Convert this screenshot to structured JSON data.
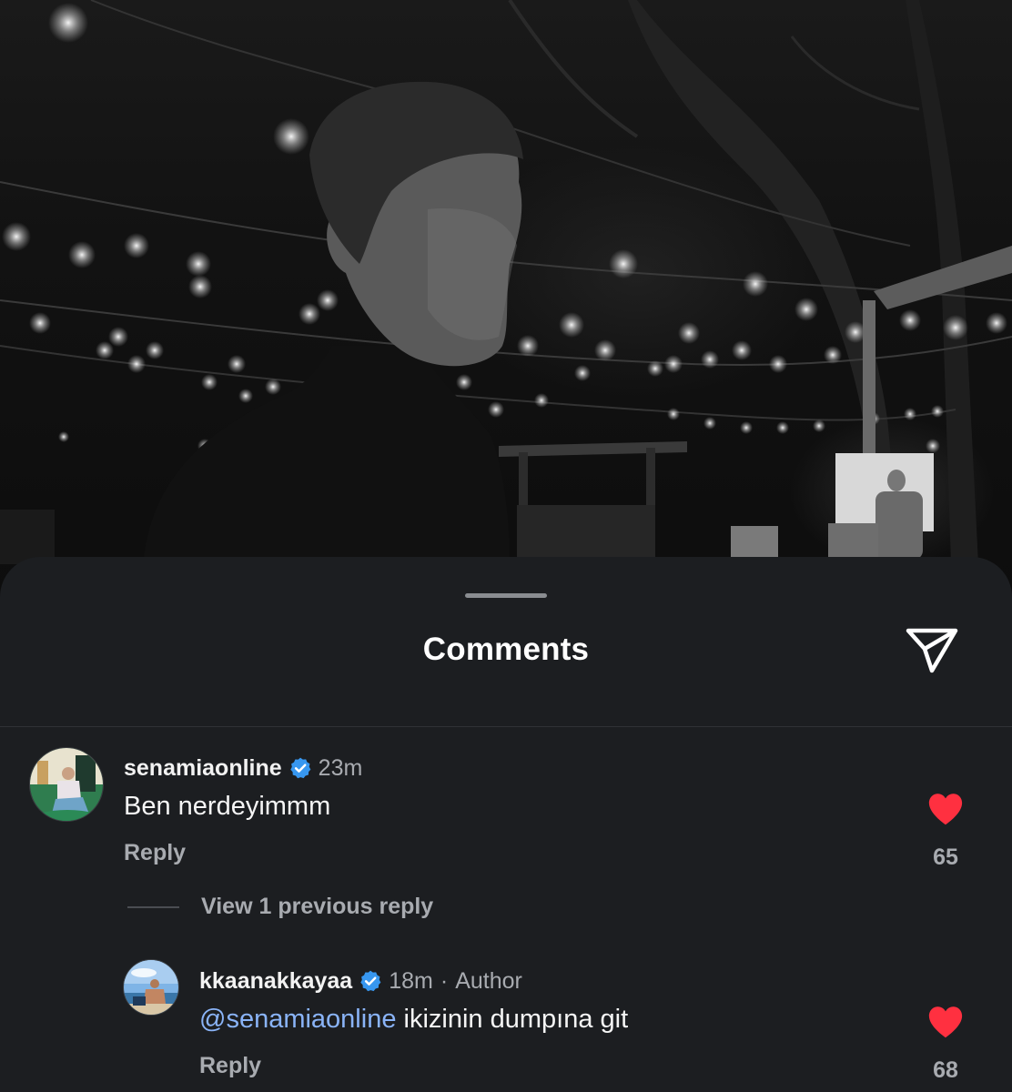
{
  "sheet": {
    "title": "Comments",
    "share_icon": "paper-plane-icon"
  },
  "comments": [
    {
      "username": "senamiaonline",
      "verified": true,
      "time": "23m",
      "text": "Ben nerdeyimmm",
      "reply_label": "Reply",
      "likes": "65",
      "liked": true
    }
  ],
  "view_replies": {
    "label": "View 1 previous reply"
  },
  "replies": [
    {
      "username": "kkaanakkayaa",
      "verified": true,
      "time": "18m",
      "separator": "·",
      "badge": "Author",
      "mention": "@senamiaonline",
      "text": " ikizinin dumpına git",
      "reply_label": "Reply",
      "likes": "68",
      "liked": true
    }
  ],
  "colors": {
    "sheet_bg": "#1c1e21",
    "heart": "#ff3040",
    "verified": "#3797f0",
    "mention": "#8ab4f8",
    "muted_text": "#a8abb0"
  }
}
